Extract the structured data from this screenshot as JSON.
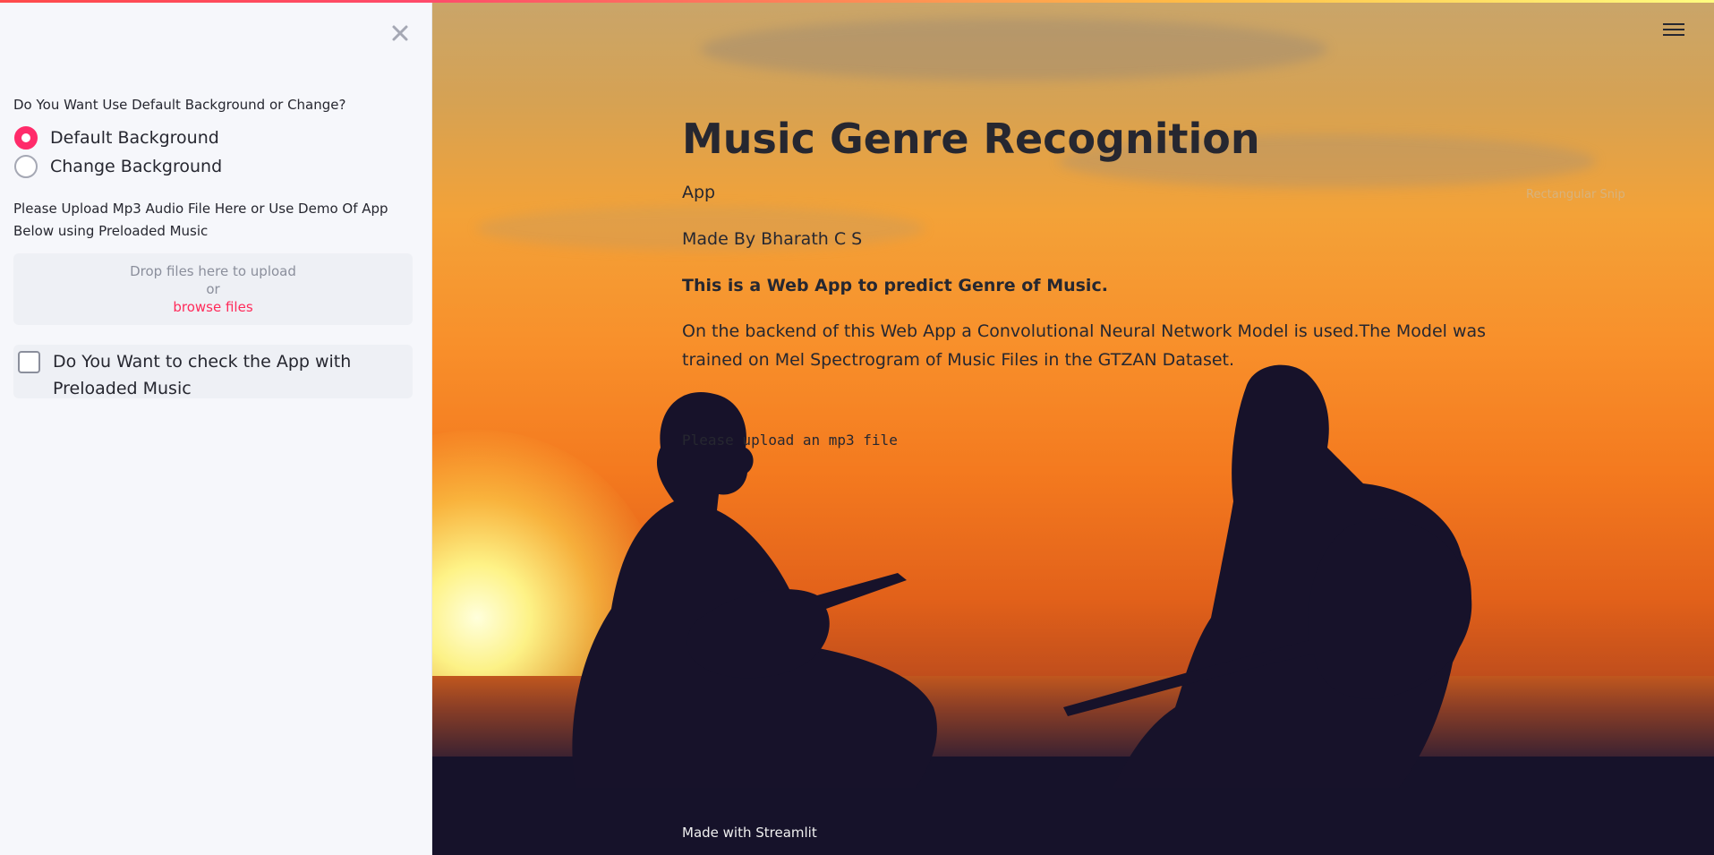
{
  "sidebar": {
    "close_label": "×",
    "background_question": "Do You Want Use Default Background or Change?",
    "background_options": [
      "Default Background",
      "Change Background"
    ],
    "selected_option": "Default Background",
    "upload_instructions_line1": "Please Upload Mp3 Audio File Here or Use Demo Of App",
    "upload_instructions_line2": "Below using Preloaded Music",
    "dropzone": {
      "drop_text": "Drop files here to upload",
      "or_text": "or",
      "browse_text": "browse files"
    },
    "preloaded_checkbox": {
      "label_line1": "Do You Want to check the App with",
      "label_line2": "Preloaded Music",
      "checked": false
    }
  },
  "main": {
    "title": "Music Genre Recognition",
    "subtitle": "App",
    "author": "Made By Bharath C S",
    "tagline": "This is a Web App to predict Genre of Music.",
    "description_line1": "On the backend of this Web App a Convolutional Neural Network Model is used.The Model was",
    "description_line2": "trained on Mel Spectrogram of Music Files in the GTZAN Dataset.",
    "status_message": "Please upload an mp3 file",
    "footer": "Made with Streamlit",
    "overlay_hint": "Rectangular Snip"
  },
  "colors": {
    "accent": "#ff2b6a",
    "sidebar_bg": "#f6f7fb",
    "text": "#262730"
  },
  "icons": {
    "close": "close-icon",
    "menu": "hamburger-menu-icon"
  }
}
